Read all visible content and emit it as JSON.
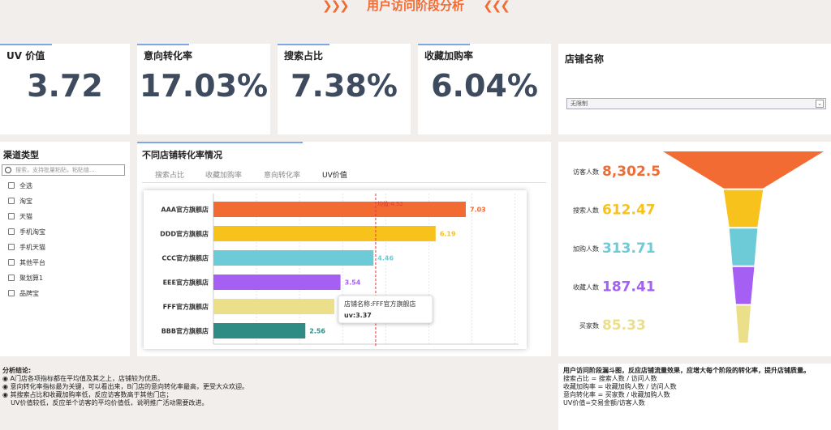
{
  "title": "用户访问阶段分析",
  "title_left_deco": "❯❯❯",
  "title_right_deco": "❮❮❮",
  "kpis": [
    {
      "label": "UV 价值",
      "value": "3.72"
    },
    {
      "label": "意向转化率",
      "value": "17.03%"
    },
    {
      "label": "搜索占比",
      "value": "7.38%"
    },
    {
      "label": "收藏加购率",
      "value": "6.04%"
    }
  ],
  "shop_filter": {
    "label": "店铺名称",
    "selected": "无限制"
  },
  "channel": {
    "title": "渠道类型",
    "search_placeholder": "搜索，支持批量粘贴，粘贴值...",
    "items": [
      "全选",
      "淘宝",
      "天猫",
      "手机淘宝",
      "手机天猫",
      "其他平台",
      "聚划算1",
      "品牌宝"
    ]
  },
  "middle": {
    "title": "不同店铺转化率情况",
    "tabs": [
      "搜索占比",
      "收藏加购率",
      "意向转化率",
      "UV价值"
    ],
    "active_tab": "UV价值",
    "avg_label": "均值:4.52",
    "tooltip": {
      "line1": "店铺名称:FFF官方旗舰店",
      "line2": "uv:3.37"
    }
  },
  "chart_data": [
    {
      "type": "bar",
      "orientation": "horizontal",
      "categories": [
        "AAA官方旗舰店",
        "DDD官方旗舰店",
        "CCC官方旗舰店",
        "EEE官方旗舰店",
        "FFF官方旗舰店",
        "BBB官方旗舰店"
      ],
      "values": [
        7.03,
        6.19,
        4.46,
        3.54,
        3.37,
        2.56
      ],
      "data_labels": [
        "7.03",
        "6.19",
        "4.46",
        "3.54",
        "",
        "2.56"
      ],
      "colors": [
        "#f26b32",
        "#f8c21c",
        "#6ccbd6",
        "#a55ff2",
        "#ecdf8a",
        "#2e8c85"
      ],
      "average": 4.52,
      "xlim": [
        0,
        8.5
      ],
      "grid": true
    },
    {
      "type": "funnel",
      "categories": [
        "访客人数",
        "搜索人数",
        "加购人数",
        "收藏人数",
        "买家数"
      ],
      "values": [
        8302.5,
        612.47,
        313.71,
        187.41,
        85.33
      ],
      "value_labels": [
        "8,302.5",
        "612.47",
        "313.71",
        "187.41",
        "85.33"
      ],
      "colors": [
        "#f26b32",
        "#f8c21c",
        "#6ccbd6",
        "#a55ff2",
        "#ecdf8a"
      ]
    }
  ],
  "analysis": {
    "heading": "分析结论:",
    "lines": [
      "◉ A门店各项指标都在平均值及其之上，店铺较为优质。",
      "◉ 意向转化率指标最为关键，可以看出来，B门店的意向转化率最高，更受大众欢迎。",
      "◉ 其搜索占比和收藏加购率低，反应访客数高于其他门店；",
      "    UV价值较低，反应单个访客的平均价值低，说明推广活动需要改进。"
    ]
  },
  "formula_notes": {
    "heading": "用户访问阶段漏斗图，反应店铺流量效果，应增大每个阶段的转化率，提升店铺质量。",
    "lines": [
      "搜索占比 = 搜索人数 / 访问人数",
      "收藏加购率 = 收藏加购人数 / 访问人数",
      "意向转化率 = 买家数 / 收藏加购人数",
      "UV价值=交易金额/访客人数"
    ]
  }
}
